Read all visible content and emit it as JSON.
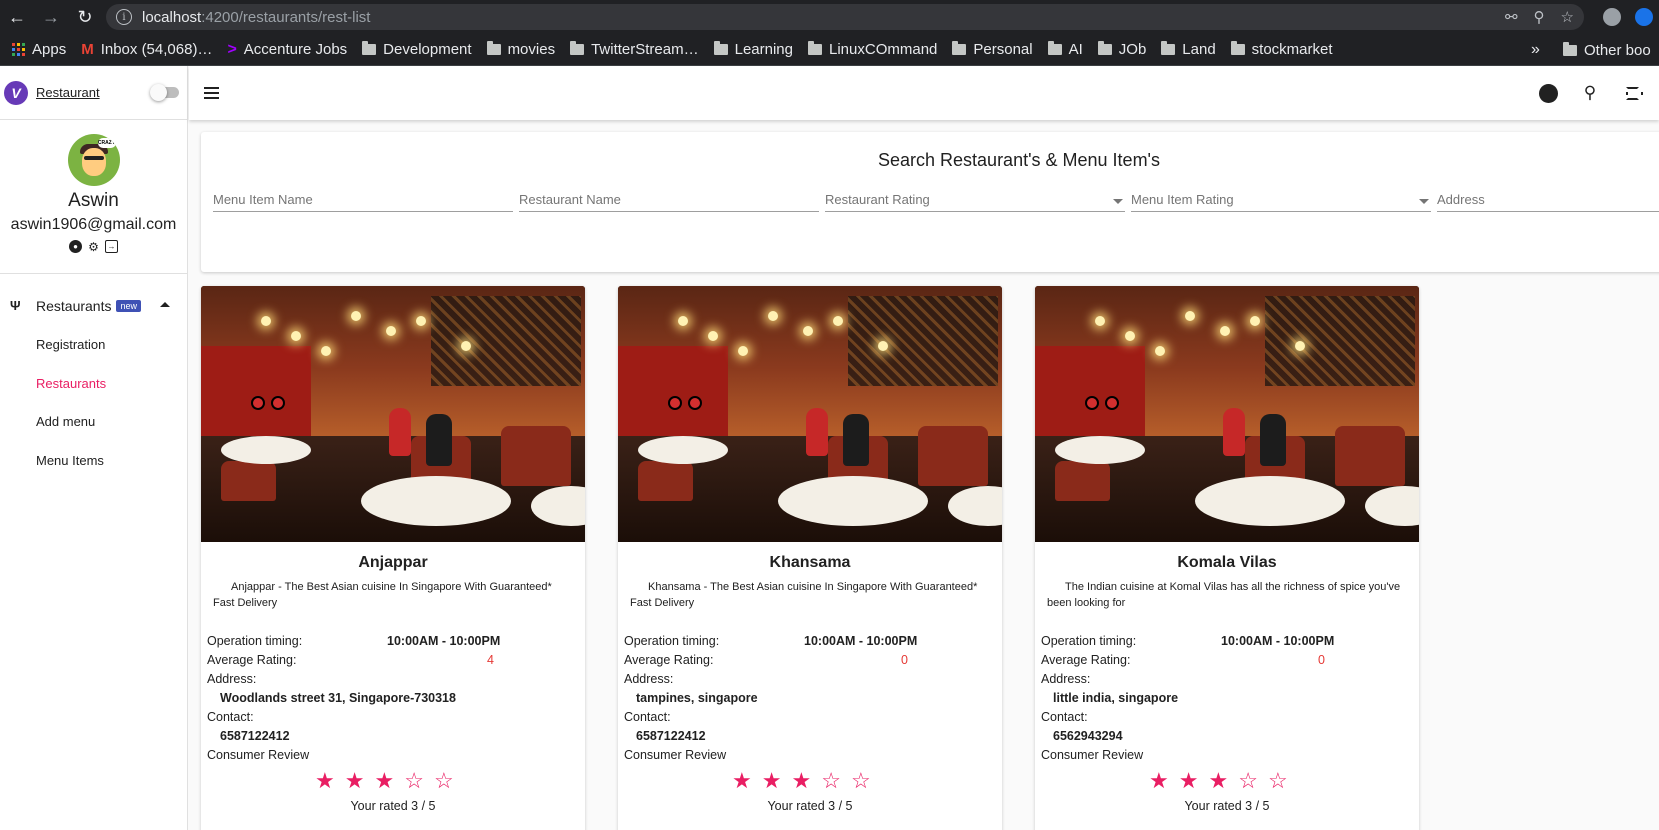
{
  "browser": {
    "url_host": "localhost",
    "url_path": ":4200/restaurants/rest-list",
    "bookmarks": [
      {
        "label": "Apps",
        "type": "apps"
      },
      {
        "label": "Inbox (54,068)…",
        "type": "gmail"
      },
      {
        "label": "Accenture Jobs",
        "type": "accenture"
      },
      {
        "label": "Development",
        "type": "folder"
      },
      {
        "label": "movies",
        "type": "folder"
      },
      {
        "label": "TwitterStream…",
        "type": "folder"
      },
      {
        "label": "Learning",
        "type": "folder"
      },
      {
        "label": "LinuxCOmmand",
        "type": "folder"
      },
      {
        "label": "Personal",
        "type": "folder"
      },
      {
        "label": "AI",
        "type": "folder"
      },
      {
        "label": "JOb",
        "type": "folder"
      },
      {
        "label": "Land",
        "type": "folder"
      },
      {
        "label": "stockmarket",
        "type": "folder"
      }
    ],
    "overflow": "»",
    "other_bookmarks": "Other boo"
  },
  "sidebar": {
    "brand": "Restaurant",
    "user": {
      "name": "Aswin",
      "email": "aswin1906@gmail.com"
    },
    "menu": {
      "label": "Restaurants",
      "badge": "new",
      "items": [
        {
          "label": "Registration",
          "active": false
        },
        {
          "label": "Restaurants",
          "active": true
        },
        {
          "label": "Add menu",
          "active": false
        },
        {
          "label": "Menu Items",
          "active": false
        }
      ]
    }
  },
  "search": {
    "title": "Search Restaurant's & Menu Item's",
    "fields": [
      {
        "placeholder": "Menu Item Name",
        "dropdown": false
      },
      {
        "placeholder": "Restaurant Name",
        "dropdown": false
      },
      {
        "placeholder": "Restaurant Rating",
        "dropdown": true
      },
      {
        "placeholder": "Menu Item Rating",
        "dropdown": true
      },
      {
        "placeholder": "Address",
        "dropdown": false
      }
    ]
  },
  "labels": {
    "operation_timing": "Operation timing:",
    "average_rating": "Average Rating:",
    "address": "Address:",
    "contact": "Contact:",
    "consumer_review": "Consumer Review"
  },
  "restaurants": [
    {
      "name": "Anjappar",
      "description": "Anjappar - The Best Asian cuisine In Singapore With Guaranteed* Fast Delivery",
      "timing": "10:00AM - 10:00PM",
      "rating": "4",
      "address": "Woodlands street 31, Singapore-730318",
      "contact": "6587122412",
      "stars_filled": 3,
      "stars_total": 5,
      "rated_text": "Your rated 3 / 5"
    },
    {
      "name": "Khansama",
      "description": "Khansama - The Best Asian cuisine In Singapore With Guaranteed* Fast Delivery",
      "timing": "10:00AM - 10:00PM",
      "rating": "0",
      "address": "tampines, singapore",
      "contact": "6587122412",
      "stars_filled": 3,
      "stars_total": 5,
      "rated_text": "Your rated 3 / 5"
    },
    {
      "name": "Komala Vilas",
      "description": "The Indian cuisine at Komal Vilas has all the richness of spice you've been looking for",
      "timing": "10:00AM - 10:00PM",
      "rating": "0",
      "address": "little india, singapore",
      "contact": "6562943294",
      "stars_filled": 3,
      "stars_total": 5,
      "rated_text": "Your rated 3 / 5"
    }
  ],
  "colors": {
    "accent": "#e91e63",
    "rating": "#e53935",
    "badge": "#3f51b5",
    "logo": "#673ab7"
  }
}
